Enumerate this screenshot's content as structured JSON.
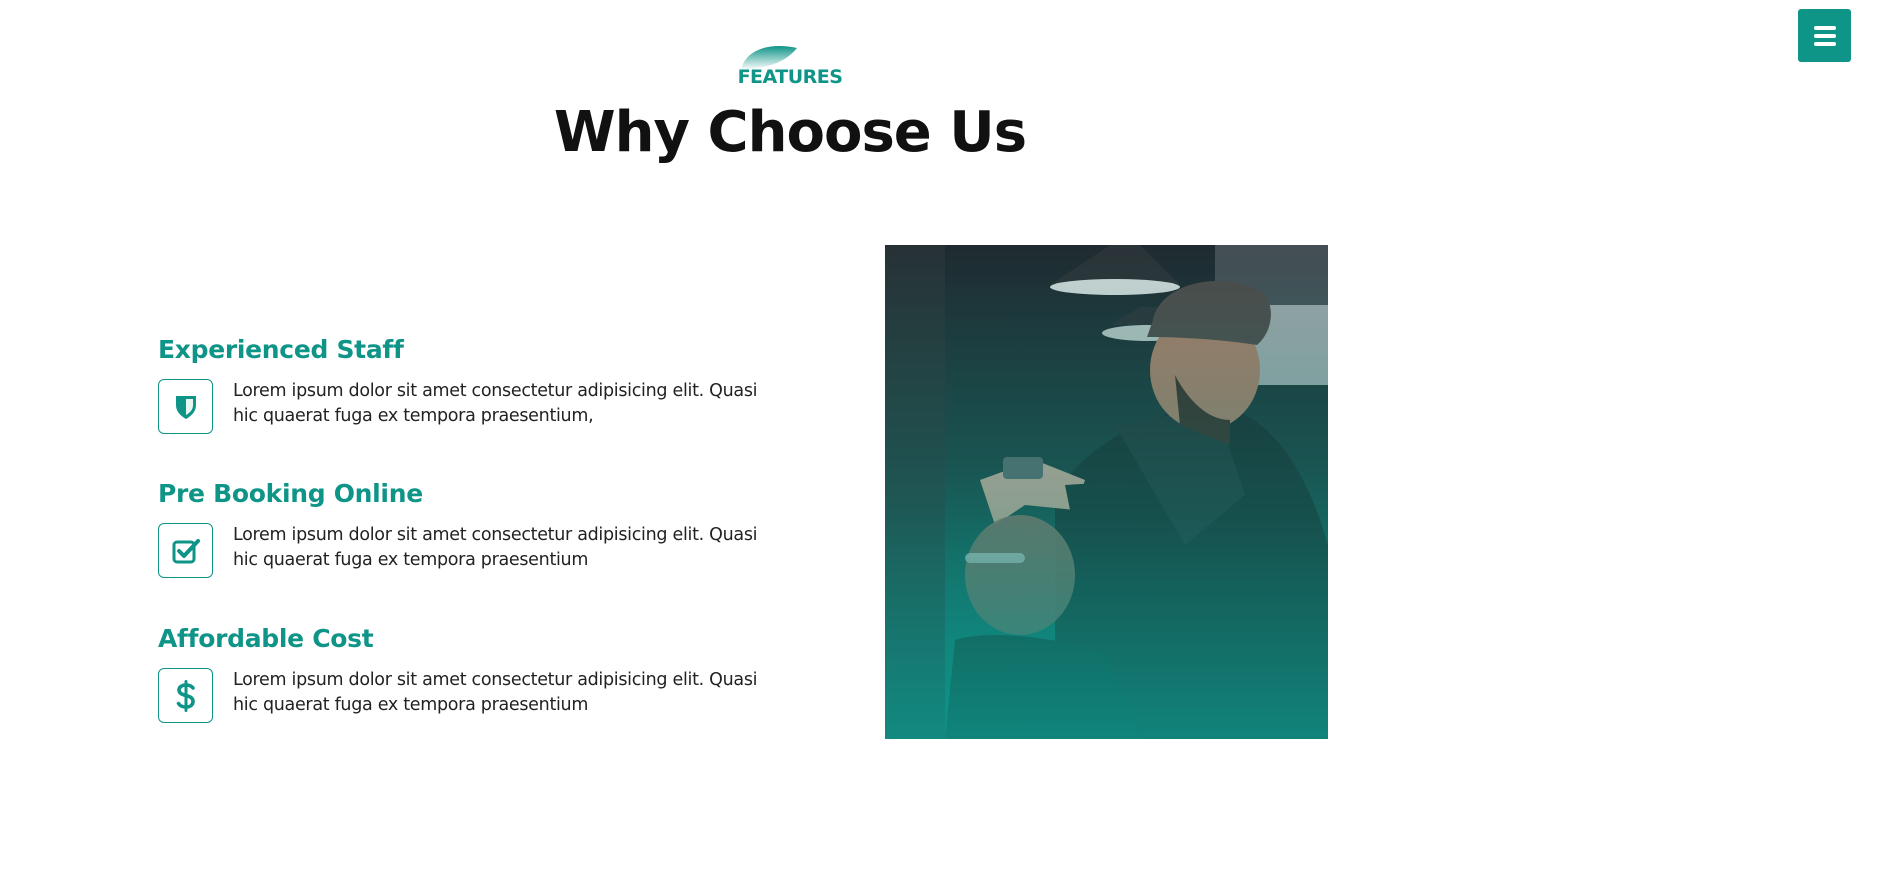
{
  "nav": {
    "menu_icon": "bars-icon"
  },
  "header": {
    "eyebrow": "FEATURES",
    "title": "Why Choose Us"
  },
  "features": [
    {
      "title": "Experienced Staff",
      "icon": "shield-icon",
      "text": "Lorem ipsum dolor sit amet consectetur adipisicing elit. Quasi hic quaerat fuga ex tempora praesentium,"
    },
    {
      "title": "Pre Booking Online",
      "icon": "check-square-icon",
      "text": "Lorem ipsum dolor sit amet consectetur adipisicing elit. Quasi hic quaerat fuga ex tempora praesentium"
    },
    {
      "title": "Affordable Cost",
      "icon": "dollar-icon",
      "text": "Lorem ipsum dolor sit amet consectetur adipisicing elit. Quasi hic quaerat fuga ex tempora praesentium"
    }
  ],
  "colors": {
    "accent": "#0f9488",
    "title": "#111111",
    "body_text": "#222222"
  }
}
